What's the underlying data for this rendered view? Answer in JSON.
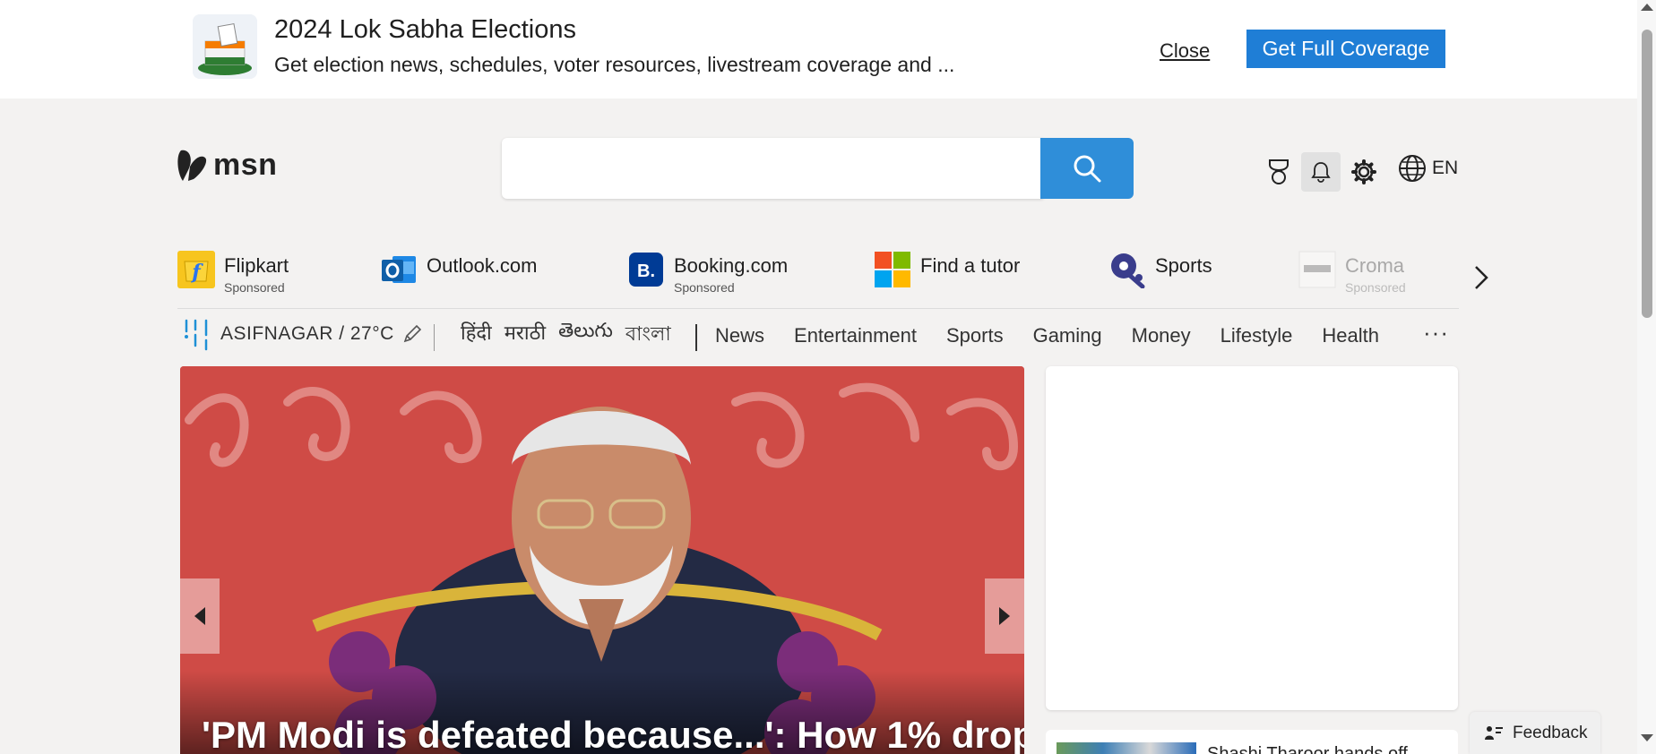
{
  "banner": {
    "title": "2024 Lok Sabha Elections",
    "subtitle": "Get election news, schedules, voter resources, livestream coverage and ...",
    "close_label": "Close",
    "cta_label": "Get Full Coverage"
  },
  "header": {
    "logo_text": "msn",
    "search_placeholder": "",
    "language": "EN",
    "icons": [
      "rewards-icon",
      "bell-icon",
      "gear-icon",
      "globe-icon"
    ]
  },
  "quicklinks": {
    "items": [
      {
        "label": "Flipkart",
        "sponsored": "Sponsored",
        "icon": "flipkart-icon"
      },
      {
        "label": "Outlook.com",
        "sponsored": "",
        "icon": "outlook-icon"
      },
      {
        "label": "Booking.com",
        "sponsored": "Sponsored",
        "icon": "booking-icon"
      },
      {
        "label": "Find a tutor",
        "sponsored": "",
        "icon": "microsoft-icon"
      },
      {
        "label": "Sports",
        "sponsored": "",
        "icon": "sports-icon"
      },
      {
        "label": "Croma",
        "sponsored": "Sponsored",
        "icon": "croma-icon"
      }
    ]
  },
  "nav": {
    "weather": "ASIFNAGAR / 27°C",
    "languages": [
      "हिंदी",
      "मराठी",
      "తెలుగు",
      "বাংলা"
    ],
    "items": [
      "News",
      "Entertainment",
      "Sports",
      "Gaming",
      "Money",
      "Lifestyle",
      "Health"
    ],
    "more": "···"
  },
  "hero": {
    "caption": "'PM Modi is defeated because...': How 1% drop"
  },
  "side_card": {
    "text": "Shashi Tharoor hands off"
  },
  "feedback": {
    "label": "Feedback"
  },
  "colors": {
    "accent": "#1f7ed6",
    "search_button": "#2f8ed9",
    "hero_background": "#cf4b46"
  }
}
